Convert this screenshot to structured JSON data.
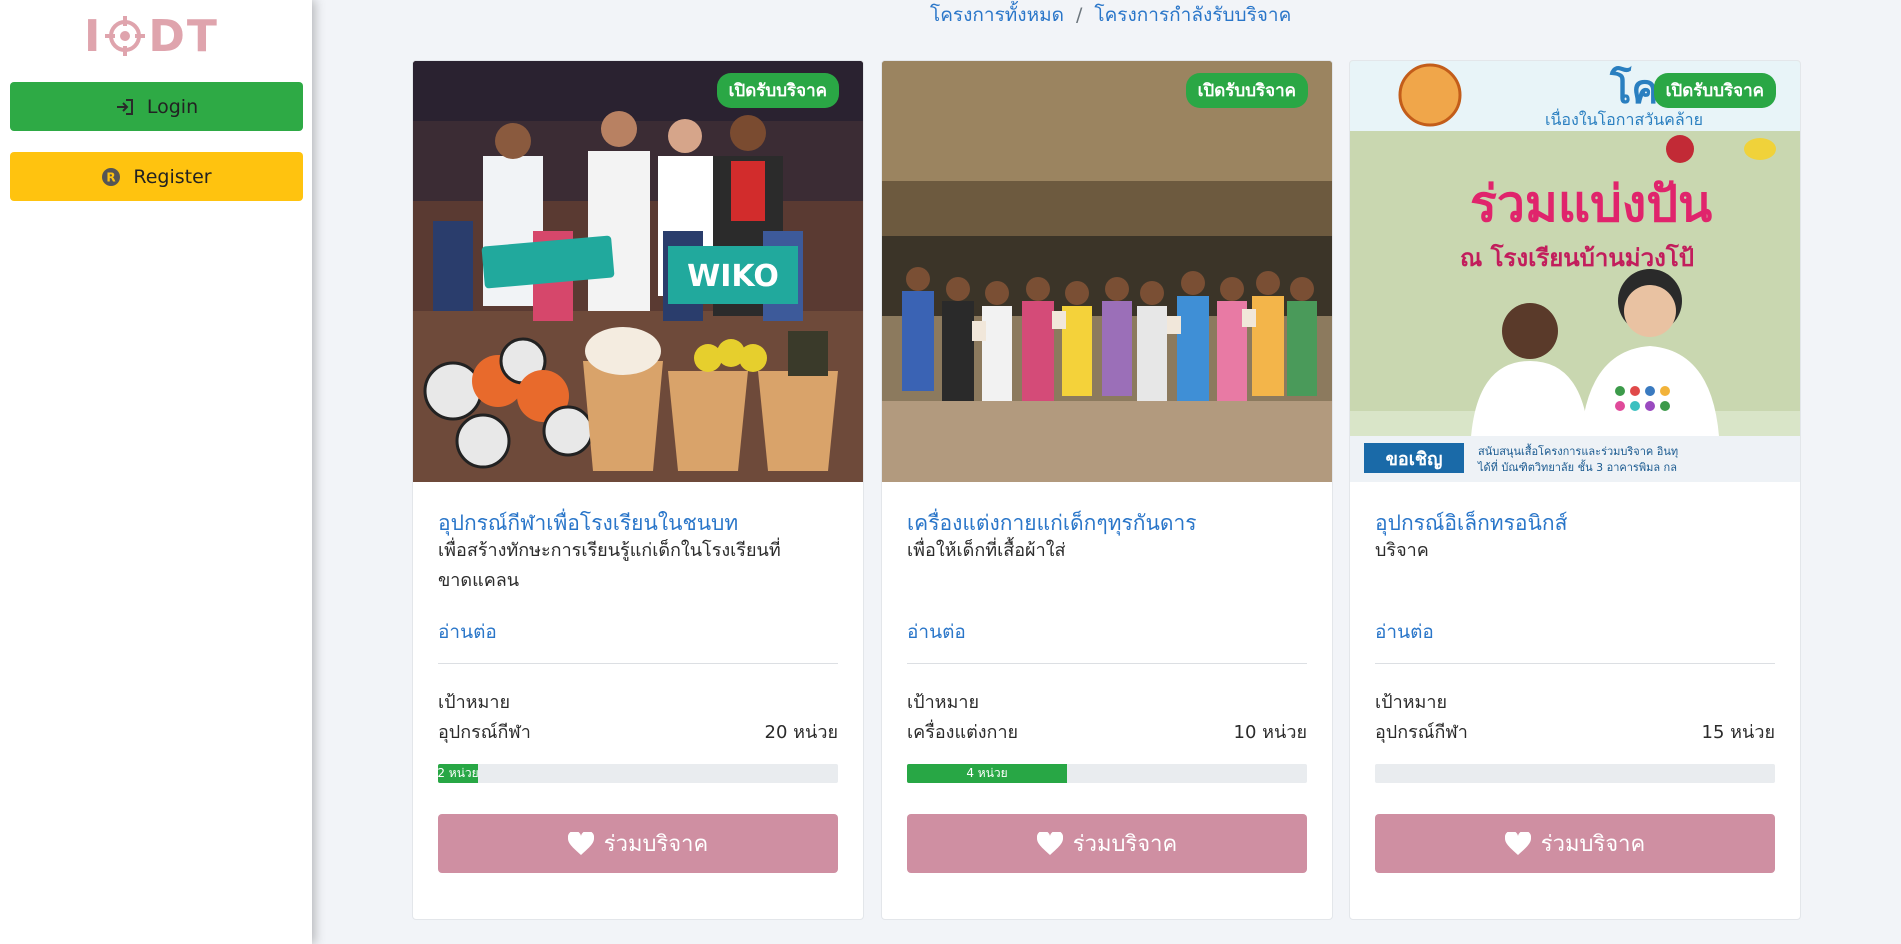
{
  "logo": {
    "text_left": "I",
    "text_right": "DT"
  },
  "sidebar": {
    "login_label": "Login",
    "register_label": "Register"
  },
  "breadcrumb": {
    "items": [
      "โครงการทั้งหมด",
      "โครงการกำลังรับบริจาค"
    ],
    "separator": "/"
  },
  "colors": {
    "brand_pink": "#dfa4ad",
    "login_green": "#2eaa45",
    "register_yellow": "#ffc30f",
    "link_blue": "#2a76c9",
    "badge_green": "#2aa745",
    "donate_pink": "#cf8fa2"
  },
  "cards": [
    {
      "badge": "เปิดรับบริจาค",
      "title": "อุปกรณ์กีฬาเพื่อโรงเรียนในชนบท",
      "description": "เพื่อสร้างทักษะการเรียนรู้แก่เด็กในโรงเรียนที่ขาดแคลน",
      "read_more": "อ่านต่อ",
      "target_label": "เป้าหมาย",
      "item": "อุปกรณ์กีฬา",
      "quantity": "20 หน่วย",
      "progress_label": "2 หน่วย",
      "progress_fraction": 0.1,
      "donate_label": "ร่วมบริจาค",
      "image": "sports-equipment-photo"
    },
    {
      "badge": "เปิดรับบริจาค",
      "title": "เครื่องแต่งกายแก่เด็กๆทุรกันดาร",
      "description": "เพื่อให้เด็กที่เสื้อผ้าใส่",
      "read_more": "อ่านต่อ",
      "target_label": "เป้าหมาย",
      "item": "เครื่องแต่งกาย",
      "quantity": "10 หน่วย",
      "progress_label": "4 หน่วย",
      "progress_fraction": 0.4,
      "donate_label": "ร่วมบริจาค",
      "image": "village-children-photo"
    },
    {
      "badge": "เปิดรับบริจาค",
      "title": "อุปกรณ์อิเล็กทรอนิกส์",
      "description": "บริจาค",
      "read_more": "อ่านต่อ",
      "target_label": "เป้าหมาย",
      "item": "อุปกรณ์กีฬา",
      "quantity": "15 หน่วย",
      "progress_label": "",
      "progress_fraction": 0,
      "donate_label": "ร่วมบริจาค",
      "image": "poster-banner",
      "poster_text": {
        "header": "โครงการ",
        "subheader": "เนื่องในโอกาสวันคล้าย",
        "headline": "ร่วมแบ่งปัน",
        "subline": "ณ โรงเรียนบ้านม่วงโป้",
        "invite": "ขอเชิญ",
        "footer_1": "สนับสนุนเสื้อโครงการและร่วมบริจาค อินทุ",
        "footer_2": "ได้ที่ บัณฑิตวิทยาลัย ชั้น 3 อาคารพิมล กล"
      }
    }
  ]
}
